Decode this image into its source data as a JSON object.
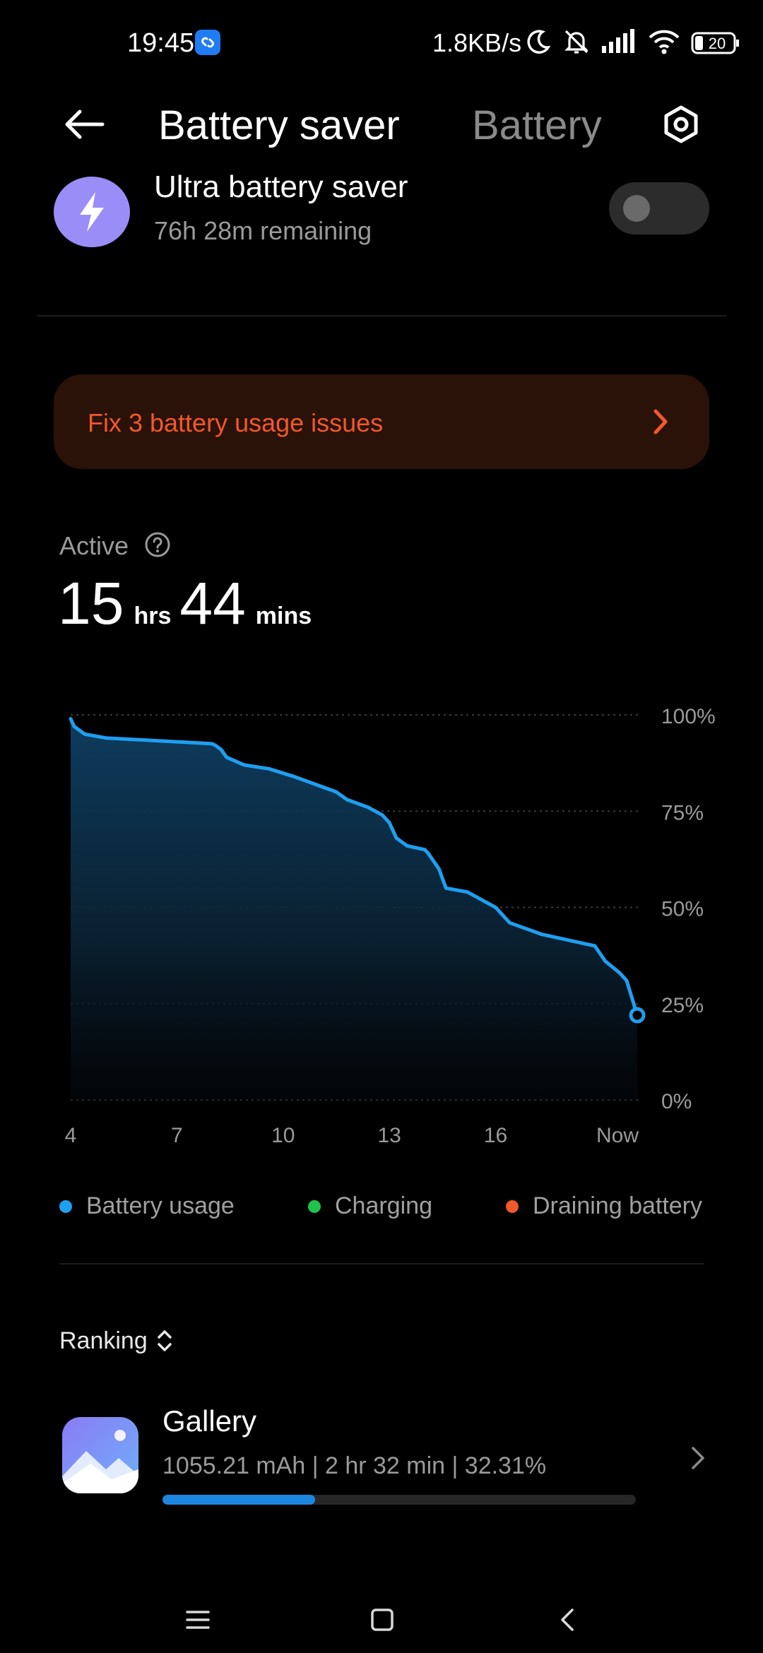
{
  "status_bar": {
    "time": "19:45",
    "network_speed": "1.8KB/s",
    "battery_level": "20",
    "icons": [
      "shazam-icon",
      "moon-icon",
      "bell-off-icon",
      "signal-icon",
      "wifi-icon",
      "battery-icon"
    ]
  },
  "header": {
    "tab_active": "Battery saver",
    "tab_inactive": "Battery"
  },
  "ultra_saver": {
    "title": "Ultra battery saver",
    "subtitle": "76h 28m remaining",
    "enabled": false
  },
  "fix_banner": {
    "label": "Fix 3 battery usage issues"
  },
  "active": {
    "label": "Active",
    "hours": "15",
    "hours_unit": "hrs",
    "minutes": "44",
    "minutes_unit": "mins"
  },
  "chart_data": {
    "type": "area",
    "x_tick_labels": [
      "4",
      "7",
      "10",
      "13",
      "16",
      "Now"
    ],
    "y_tick_labels": [
      "100%",
      "75%",
      "50%",
      "25%",
      "0%"
    ],
    "ylim": [
      0,
      100
    ],
    "xlim": [
      4,
      20
    ],
    "grid": true,
    "series": [
      {
        "name": "Battery usage",
        "color": "#1e9ff0",
        "x": [
          4.0,
          4.1,
          4.4,
          5.0,
          6.0,
          7.0,
          8.0,
          8.1,
          8.25,
          8.4,
          8.9,
          9.6,
          10.3,
          10.9,
          11.5,
          11.8,
          12.4,
          12.8,
          13.0,
          13.2,
          13.5,
          14.0,
          14.1,
          14.4,
          14.6,
          15.2,
          15.4,
          15.6,
          16.0,
          16.4,
          17.3,
          17.8,
          18.3,
          18.8,
          19.1,
          19.5,
          19.7,
          20.0
        ],
        "y": [
          99,
          97,
          95,
          94,
          93.5,
          93,
          92.5,
          92,
          91,
          89,
          87,
          86,
          84,
          82,
          80,
          78,
          76,
          74,
          72,
          68,
          66,
          65,
          64,
          60,
          55,
          54,
          53,
          52,
          50,
          46,
          43,
          42,
          41,
          40,
          36,
          33,
          31,
          22
        ]
      }
    ],
    "current_point": {
      "x": 20.0,
      "y": 22
    }
  },
  "legend": [
    {
      "label": "Battery usage",
      "color": "#1e9ff0"
    },
    {
      "label": "Charging",
      "color": "#1fc24a"
    },
    {
      "label": "Draining battery",
      "color": "#f2582c"
    }
  ],
  "ranking": {
    "label": "Ranking"
  },
  "apps": [
    {
      "name": "Gallery",
      "stats": "1055.21 mAh | 2 hr 32 min  | 32.31%",
      "share_percent": 32.31
    }
  ],
  "nav": {
    "icons": [
      "menu-icon",
      "home-icon",
      "back-nav-icon"
    ]
  }
}
